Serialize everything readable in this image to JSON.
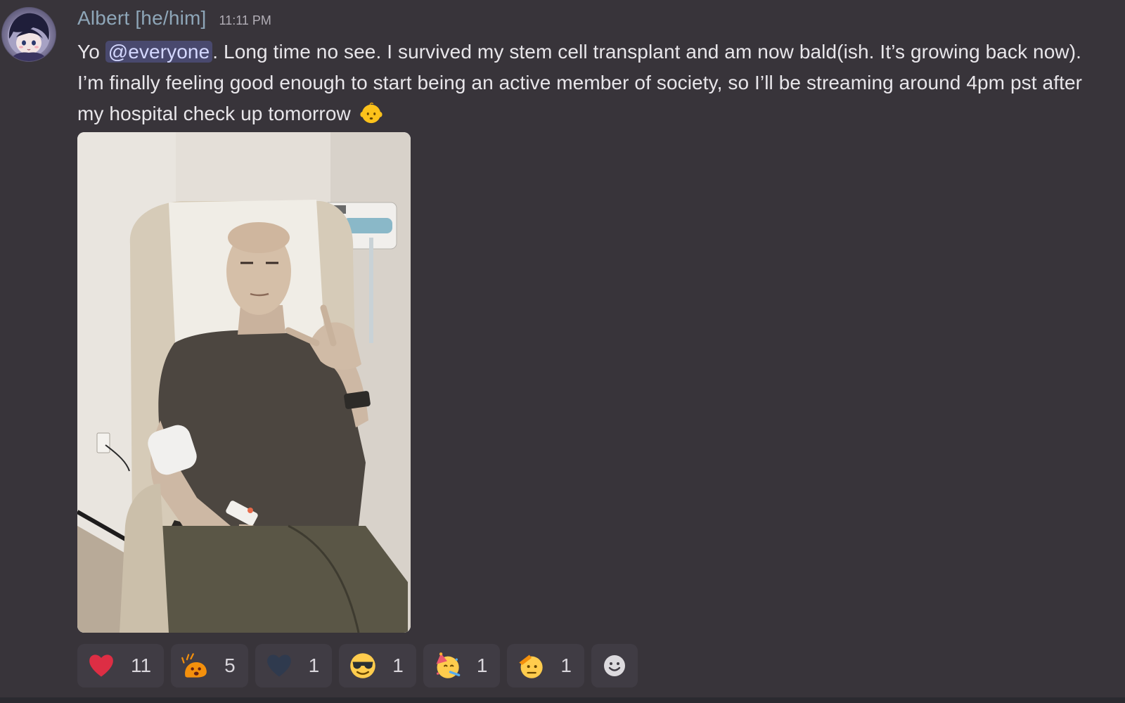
{
  "message": {
    "author": "Albert [he/him]",
    "timestamp": "11:11 PM",
    "text_before_mention": "Yo ",
    "mention": "@everyone",
    "text_after_mention": ". Long time no see. I survived my stem cell transplant and am now bald(ish. It’s growing back now). I’m finally feeling good enough to start being an active member of society, so I’ll be streaming around 4pm pst after my hospital check up tomorrow",
    "trailing_emoji": "baby-face-icon"
  },
  "attachment": {
    "type": "image"
  },
  "reactions": [
    {
      "icon": "red-heart-icon",
      "count": "11"
    },
    {
      "icon": "exploding-blob-icon",
      "count": "5"
    },
    {
      "icon": "dark-heart-icon",
      "count": "1"
    },
    {
      "icon": "sunglasses-face-icon",
      "count": "1"
    },
    {
      "icon": "party-face-icon",
      "count": "1"
    },
    {
      "icon": "saluting-face-icon",
      "count": "1"
    }
  ],
  "add_reaction_icon": "smiley-add-reaction-icon",
  "colors": {
    "background": "#38343a",
    "username": "#8ea6b8",
    "mention_bg": "#49496e",
    "reaction_bg": "#403c44"
  }
}
